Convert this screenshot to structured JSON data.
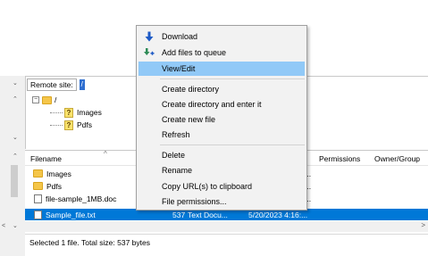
{
  "remote_site": {
    "label": "Remote site:",
    "path": "/"
  },
  "tree": {
    "root": "/",
    "children": [
      "Images",
      "Pdfs"
    ]
  },
  "file_list": {
    "columns": {
      "filename": "Filename",
      "permissions": "Permissions",
      "owner": "Owner/Group"
    },
    "rows": [
      {
        "name": "Images",
        "type": "folder",
        "trail": "..."
      },
      {
        "name": "Pdfs",
        "type": "folder",
        "trail": "..."
      },
      {
        "name": "file-sample_1MB.doc",
        "type": "file",
        "trail": "..."
      },
      {
        "name": "Sample_file.txt",
        "type": "file",
        "size": "537",
        "kind": "Text Docu...",
        "modified": "5/20/2023 4:16:...",
        "selected": true
      }
    ]
  },
  "status": {
    "text": "Selected 1 file. Total size: 537 bytes"
  },
  "context_menu": {
    "items": [
      {
        "label": "Download",
        "icon": "download-arrow-icon"
      },
      {
        "label": "Add files to queue",
        "icon": "add-queue-icon"
      },
      {
        "label": "View/Edit",
        "highlighted": true
      },
      {
        "label": "Create directory"
      },
      {
        "label": "Create directory and enter it"
      },
      {
        "label": "Create new file"
      },
      {
        "label": "Refresh"
      },
      {
        "label": "Delete"
      },
      {
        "label": "Rename"
      },
      {
        "label": "Copy URL(s) to clipboard"
      },
      {
        "label": "File permissions..."
      }
    ]
  },
  "colors": {
    "selection": "#0078d7",
    "menu_highlight": "#91c9f7",
    "download_icon": "#1e5bc6",
    "queue_icon": "#2e8b57"
  }
}
